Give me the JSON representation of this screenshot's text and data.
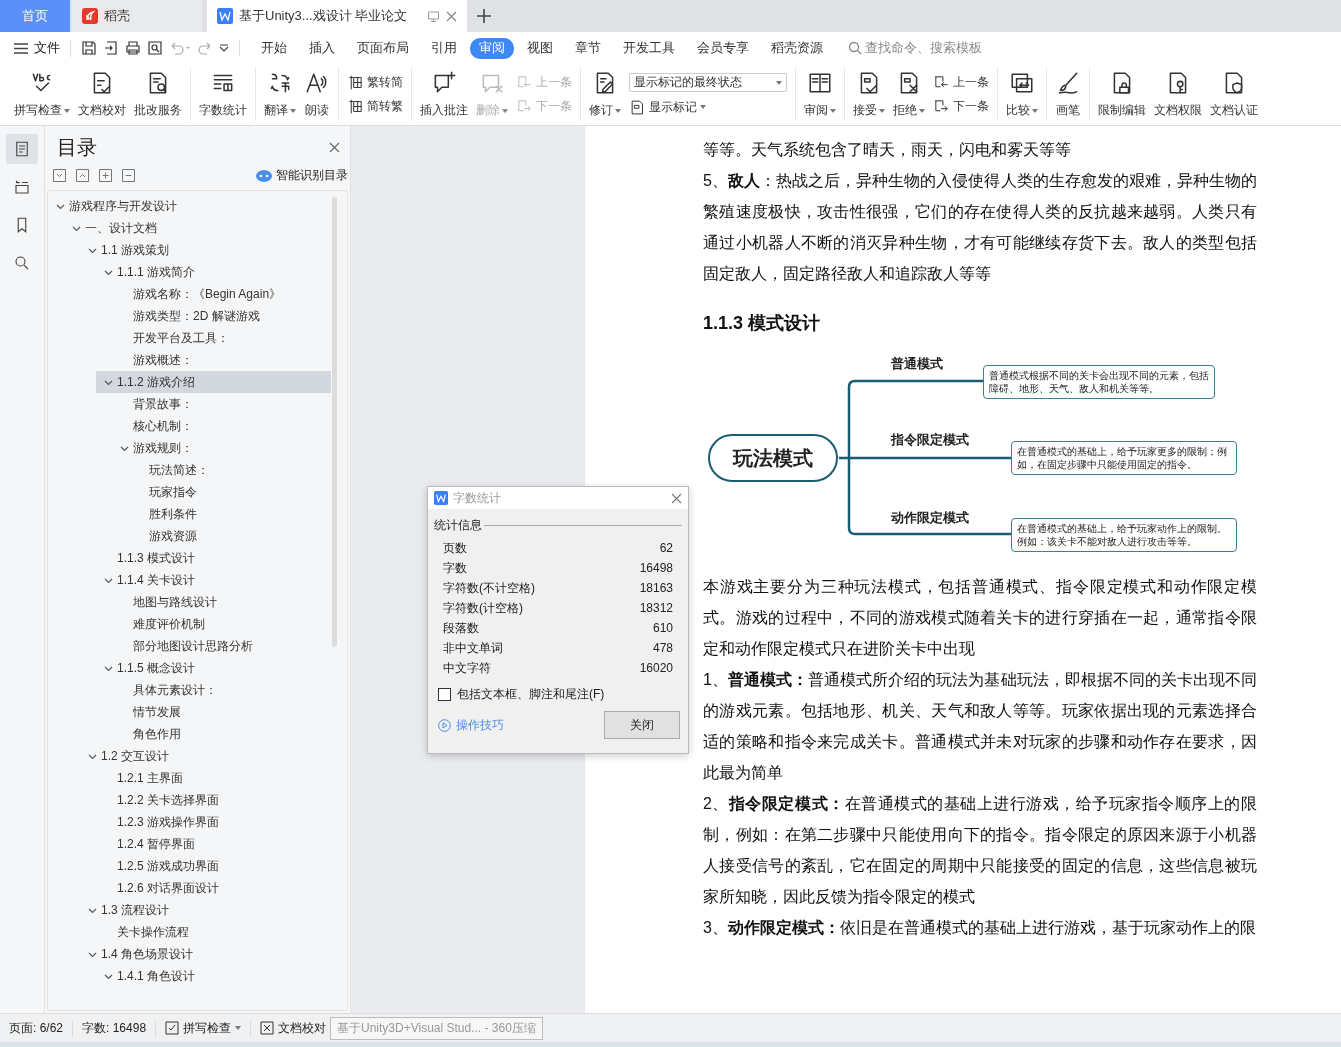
{
  "tabs": [
    {
      "kind": "home",
      "label": "首页",
      "selected": false
    },
    {
      "kind": "app",
      "label": "稻壳",
      "selected": false
    },
    {
      "kind": "document",
      "label": "基于Unity3...戏设计 毕业论文",
      "selected": true
    }
  ],
  "menu": {
    "file": "文件",
    "items": [
      {
        "label": "开始",
        "selected": false
      },
      {
        "label": "插入",
        "selected": false
      },
      {
        "label": "页面布局",
        "selected": false
      },
      {
        "label": "引用",
        "selected": false
      },
      {
        "label": "审阅",
        "selected": true
      },
      {
        "label": "视图",
        "selected": false
      },
      {
        "label": "章节",
        "selected": false
      },
      {
        "label": "开发工具",
        "selected": false
      },
      {
        "label": "会员专享",
        "selected": false
      },
      {
        "label": "稻壳资源",
        "selected": false
      }
    ],
    "search": {
      "placeholder": "查找命令、搜索模板"
    }
  },
  "ribbon": [
    {
      "items": [
        {
          "kind": "large",
          "label": "拼写检查",
          "caret": true,
          "disabled": false
        },
        {
          "kind": "large",
          "label": "文档校对",
          "caret": false,
          "disabled": false
        },
        {
          "kind": "large",
          "label": "批改服务",
          "caret": false,
          "disabled": false
        }
      ]
    },
    {
      "items": [
        {
          "kind": "large",
          "label": "字数统计",
          "caret": false,
          "disabled": false
        }
      ]
    },
    {
      "items": [
        {
          "kind": "large",
          "label": "翻译",
          "caret": true,
          "disabled": false
        },
        {
          "kind": "large",
          "label": "朗读",
          "caret": false,
          "disabled": false
        }
      ]
    },
    {
      "items": [
        {
          "kind": "stack",
          "items": [
            {
              "kind": "small",
              "label": "繁转简",
              "caret": false,
              "disabled": false
            },
            {
              "kind": "small",
              "label": "简转繁",
              "caret": false,
              "disabled": false
            }
          ]
        }
      ]
    },
    {
      "items": [
        {
          "kind": "large",
          "label": "插入批注",
          "caret": false,
          "disabled": false
        },
        {
          "kind": "large",
          "label": "删除",
          "caret": true,
          "disabled": true
        },
        {
          "kind": "stack",
          "items": [
            {
              "kind": "small",
              "label": "上一条",
              "caret": false,
              "disabled": true
            },
            {
              "kind": "small",
              "label": "下一条",
              "caret": false,
              "disabled": true
            }
          ]
        }
      ]
    },
    {
      "items": [
        {
          "kind": "large",
          "label": "修订",
          "caret": true,
          "disabled": false
        },
        {
          "kind": "stack",
          "items": [
            {
              "kind": "select",
              "label": "显示标记的最终状态"
            },
            {
              "kind": "small",
              "label": "显示标记",
              "caret": true,
              "disabled": false
            }
          ]
        }
      ]
    },
    {
      "items": [
        {
          "kind": "large",
          "label": "审阅",
          "caret": true,
          "disabled": false
        }
      ]
    },
    {
      "items": [
        {
          "kind": "large",
          "label": "接受",
          "caret": true,
          "disabled": false
        },
        {
          "kind": "large",
          "label": "拒绝",
          "caret": true,
          "disabled": false
        },
        {
          "kind": "stack",
          "items": [
            {
              "kind": "small",
              "label": "上一条",
              "caret": false,
              "disabled": false
            },
            {
              "kind": "small",
              "label": "下一条",
              "caret": false,
              "disabled": false
            }
          ]
        }
      ]
    },
    {
      "items": [
        {
          "kind": "large",
          "label": "比较",
          "caret": true,
          "disabled": false
        }
      ]
    },
    {
      "items": [
        {
          "kind": "large",
          "label": "画笔",
          "caret": false,
          "disabled": false
        }
      ]
    },
    {
      "items": [
        {
          "kind": "large",
          "label": "限制编辑",
          "caret": false,
          "disabled": false
        },
        {
          "kind": "large",
          "label": "文档权限",
          "caret": false,
          "disabled": false
        },
        {
          "kind": "large",
          "label": "文档认证",
          "caret": false,
          "disabled": false
        }
      ]
    }
  ],
  "sidebar": {
    "rail": [
      {
        "selected": true
      },
      {
        "selected": false
      },
      {
        "selected": false
      },
      {
        "selected": false
      }
    ],
    "title": "目录",
    "smart_button": "智能识别目录",
    "toc": [
      {
        "label": "游戏程序与开发设计",
        "selected": false,
        "expanded": true,
        "children": [
          {
            "label": "一、设计文档",
            "selected": false,
            "expanded": true,
            "children": [
              {
                "label": "1.1 游戏策划",
                "selected": false,
                "expanded": true,
                "children": [
                  {
                    "label": "1.1.1 游戏简介",
                    "selected": false,
                    "expanded": true,
                    "children": [
                      {
                        "label": "游戏名称：《Begin Again》",
                        "selected": false
                      },
                      {
                        "label": "游戏类型：2D 解谜游戏",
                        "selected": false
                      },
                      {
                        "label": "开发平台及工具：",
                        "selected": false
                      },
                      {
                        "label": "游戏概述：",
                        "selected": false
                      }
                    ]
                  },
                  {
                    "label": "1.1.2 游戏介绍",
                    "selected": true,
                    "expanded": true,
                    "children": [
                      {
                        "label": "背景故事：",
                        "selected": false
                      },
                      {
                        "label": "核心机制：",
                        "selected": false
                      },
                      {
                        "label": "游戏规则：",
                        "selected": false,
                        "expanded": true,
                        "children": [
                          {
                            "label": "玩法简述：",
                            "selected": false
                          },
                          {
                            "label": "玩家指令",
                            "selected": false
                          },
                          {
                            "label": "胜利条件",
                            "selected": false
                          },
                          {
                            "label": "游戏资源",
                            "selected": false
                          }
                        ]
                      }
                    ]
                  },
                  {
                    "label": "1.1.3 模式设计",
                    "selected": false
                  },
                  {
                    "label": "1.1.4 关卡设计",
                    "selected": false,
                    "expanded": true,
                    "children": [
                      {
                        "label": "地图与路线设计",
                        "selected": false
                      },
                      {
                        "label": "难度评价机制",
                        "selected": false
                      },
                      {
                        "label": "部分地图设计思路分析",
                        "selected": false
                      }
                    ]
                  },
                  {
                    "label": "1.1.5 概念设计",
                    "selected": false,
                    "expanded": true,
                    "children": [
                      {
                        "label": "具体元素设计：",
                        "selected": false
                      },
                      {
                        "label": "情节发展",
                        "selected": false
                      },
                      {
                        "label": "角色作用",
                        "selected": false
                      }
                    ]
                  }
                ]
              },
              {
                "label": "1.2 交互设计",
                "selected": false,
                "expanded": true,
                "children": [
                  {
                    "label": "1.2.1 主界面",
                    "selected": false
                  },
                  {
                    "label": "1.2.2 关卡选择界面",
                    "selected": false
                  },
                  {
                    "label": "1.2.3 游戏操作界面",
                    "selected": false
                  },
                  {
                    "label": "1.2.4 暂停界面",
                    "selected": false
                  },
                  {
                    "label": "1.2.5 游戏成功界面",
                    "selected": false
                  },
                  {
                    "label": "1.2.6 对话界面设计",
                    "selected": false
                  }
                ]
              },
              {
                "label": "1.3 流程设计",
                "selected": false,
                "expanded": true,
                "children": [
                  {
                    "label": "关卡操作流程",
                    "selected": false
                  }
                ]
              },
              {
                "label": "1.4 角色场景设计",
                "selected": false,
                "expanded": true,
                "children": [
                  {
                    "label": "1.4.1 角色设计",
                    "selected": false,
                    "expanded": true
                  }
                ]
              }
            ]
          }
        ]
      }
    ]
  },
  "document": {
    "blocks": [
      {
        "kind": "paragraph",
        "text": "等等。天气系统包含了晴天，雨天，闪电和雾天等等"
      },
      {
        "kind": "paragraph",
        "text": "5、**敌人**：热战之后，异种生物的入侵使得人类的生存愈发的艰难，异种生物的繁殖速度极快，攻击性很强，它们的存在使得人类的反抗越来越弱。人类只有通过小机器人不断的消灭异种生物，才有可能继续存货下去。敌人的类型包括固定敌人，固定路径敌人和追踪敌人等等"
      },
      {
        "kind": "heading",
        "text": "1.1.3 模式设计"
      },
      {
        "kind": "mindmap",
        "root": "玩法模式",
        "branches": [
          {
            "label": "普通模式",
            "note": "普通模式根据不同的关卡会出现不同的元素，包括障碍、地形、天气、敌人和机关等等。"
          },
          {
            "label": "指令限定模式",
            "note": "在普通模式的基础上，给予玩家更多的限制；例如，在固定步骤中只能使用固定的指令。"
          },
          {
            "label": "动作限定模式",
            "note": "在普通模式的基础上，给予玩家动作上的限制。例如：该关卡不能对敌人进行攻击等等。"
          }
        ]
      },
      {
        "kind": "paragraph",
        "text": "本游戏主要分为三种玩法模式，包括普通模式、指令限定模式和动作限定模式。游戏的过程中，不同的游戏模式随着关卡的进行穿插在一起，通常指令限定和动作限定模式只在进阶关卡中出现"
      },
      {
        "kind": "paragraph",
        "text": "1、**普通模式：**普通模式所介绍的玩法为基础玩法，即根据不同的关卡出现不同的游戏元素。包括地形、机关、天气和敌人等等。玩家依据出现的元素选择合适的策略和指令来完成关卡。普通模式并未对玩家的步骤和动作存在要求，因此最为简单"
      },
      {
        "kind": "paragraph",
        "text": "2、**指令限定模式：**在普通模式的基础上进行游戏，给予玩家指令顺序上的限制，例如：在第二步骤中只能使用向下的指令。指令限定的原因来源于小机器人接受信号的紊乱，它在固定的周期中只能接受的固定的信息，这些信息被玩家所知晓，因此反馈为指令限定的模式"
      },
      {
        "kind": "paragraph",
        "text": "3、**动作限定模式：**依旧是在普通模式的基础上进行游戏，基于玩家动作上的限"
      }
    ]
  },
  "dialog": {
    "title": "字数统计",
    "section": "统计信息",
    "rows": [
      {
        "label": "页数",
        "value": "62"
      },
      {
        "label": "字数",
        "value": "16498"
      },
      {
        "label": "字符数(不计空格)",
        "value": "18163"
      },
      {
        "label": "字符数(计空格)",
        "value": "18312"
      },
      {
        "label": "段落数",
        "value": "610"
      },
      {
        "label": "非中文单词",
        "value": "478"
      },
      {
        "label": "中文字符",
        "value": "16020"
      }
    ],
    "checkbox": {
      "label": "包括文本框、脚注和尾注(F)",
      "checked": false
    },
    "tips_link": "操作技巧",
    "close_button": "关闭"
  },
  "status_bar": {
    "page": "页面: 6/62",
    "words": "字数: 16498",
    "spell": "拼写检查",
    "proof": "文档校对",
    "tooltip": "基于Unity3D+Visual Stud... - 360压缩"
  }
}
